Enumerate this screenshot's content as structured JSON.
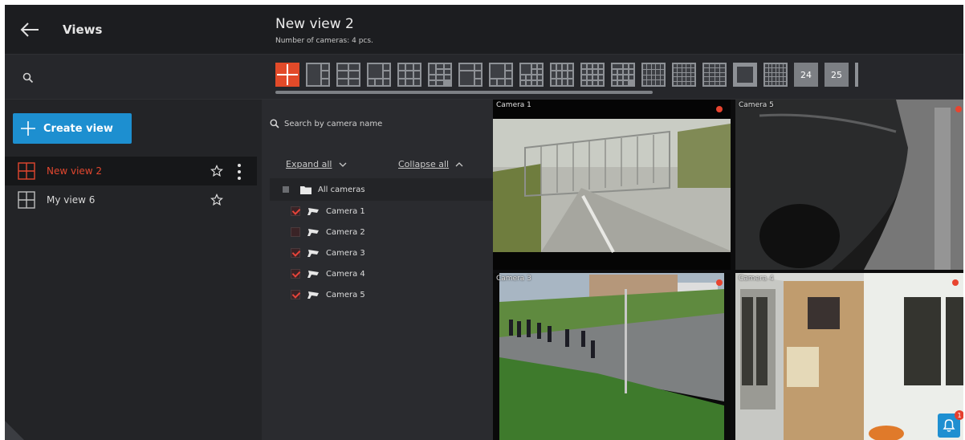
{
  "sidebar": {
    "title": "Views",
    "create_label": "Create view",
    "views": [
      {
        "label": "New view 2",
        "active": true
      },
      {
        "label": "My view 6",
        "active": false
      }
    ]
  },
  "view": {
    "title": "New view 2",
    "subtitle": "Number of cameras: 4 pcs."
  },
  "layouts": {
    "num_a": "24",
    "num_b": "25"
  },
  "tree": {
    "search_placeholder": "Search by camera name",
    "expand_label": "Expand all",
    "collapse_label": "Collapse all",
    "root_label": "All cameras",
    "cameras": [
      {
        "label": "Camera 1",
        "checked": true
      },
      {
        "label": "Camera 2",
        "checked": false
      },
      {
        "label": "Camera 3",
        "checked": true
      },
      {
        "label": "Camera 4",
        "checked": true
      },
      {
        "label": "Camera 5",
        "checked": true
      }
    ]
  },
  "tiles": [
    {
      "label": "Camera 1"
    },
    {
      "label": "Camera 5"
    },
    {
      "label": "Camera 3"
    },
    {
      "label": "Camera 4"
    }
  ],
  "notifications": {
    "count": "1"
  },
  "colors": {
    "accent": "#e24a29",
    "primary": "#1d8fd0",
    "background": "#1f2023"
  }
}
